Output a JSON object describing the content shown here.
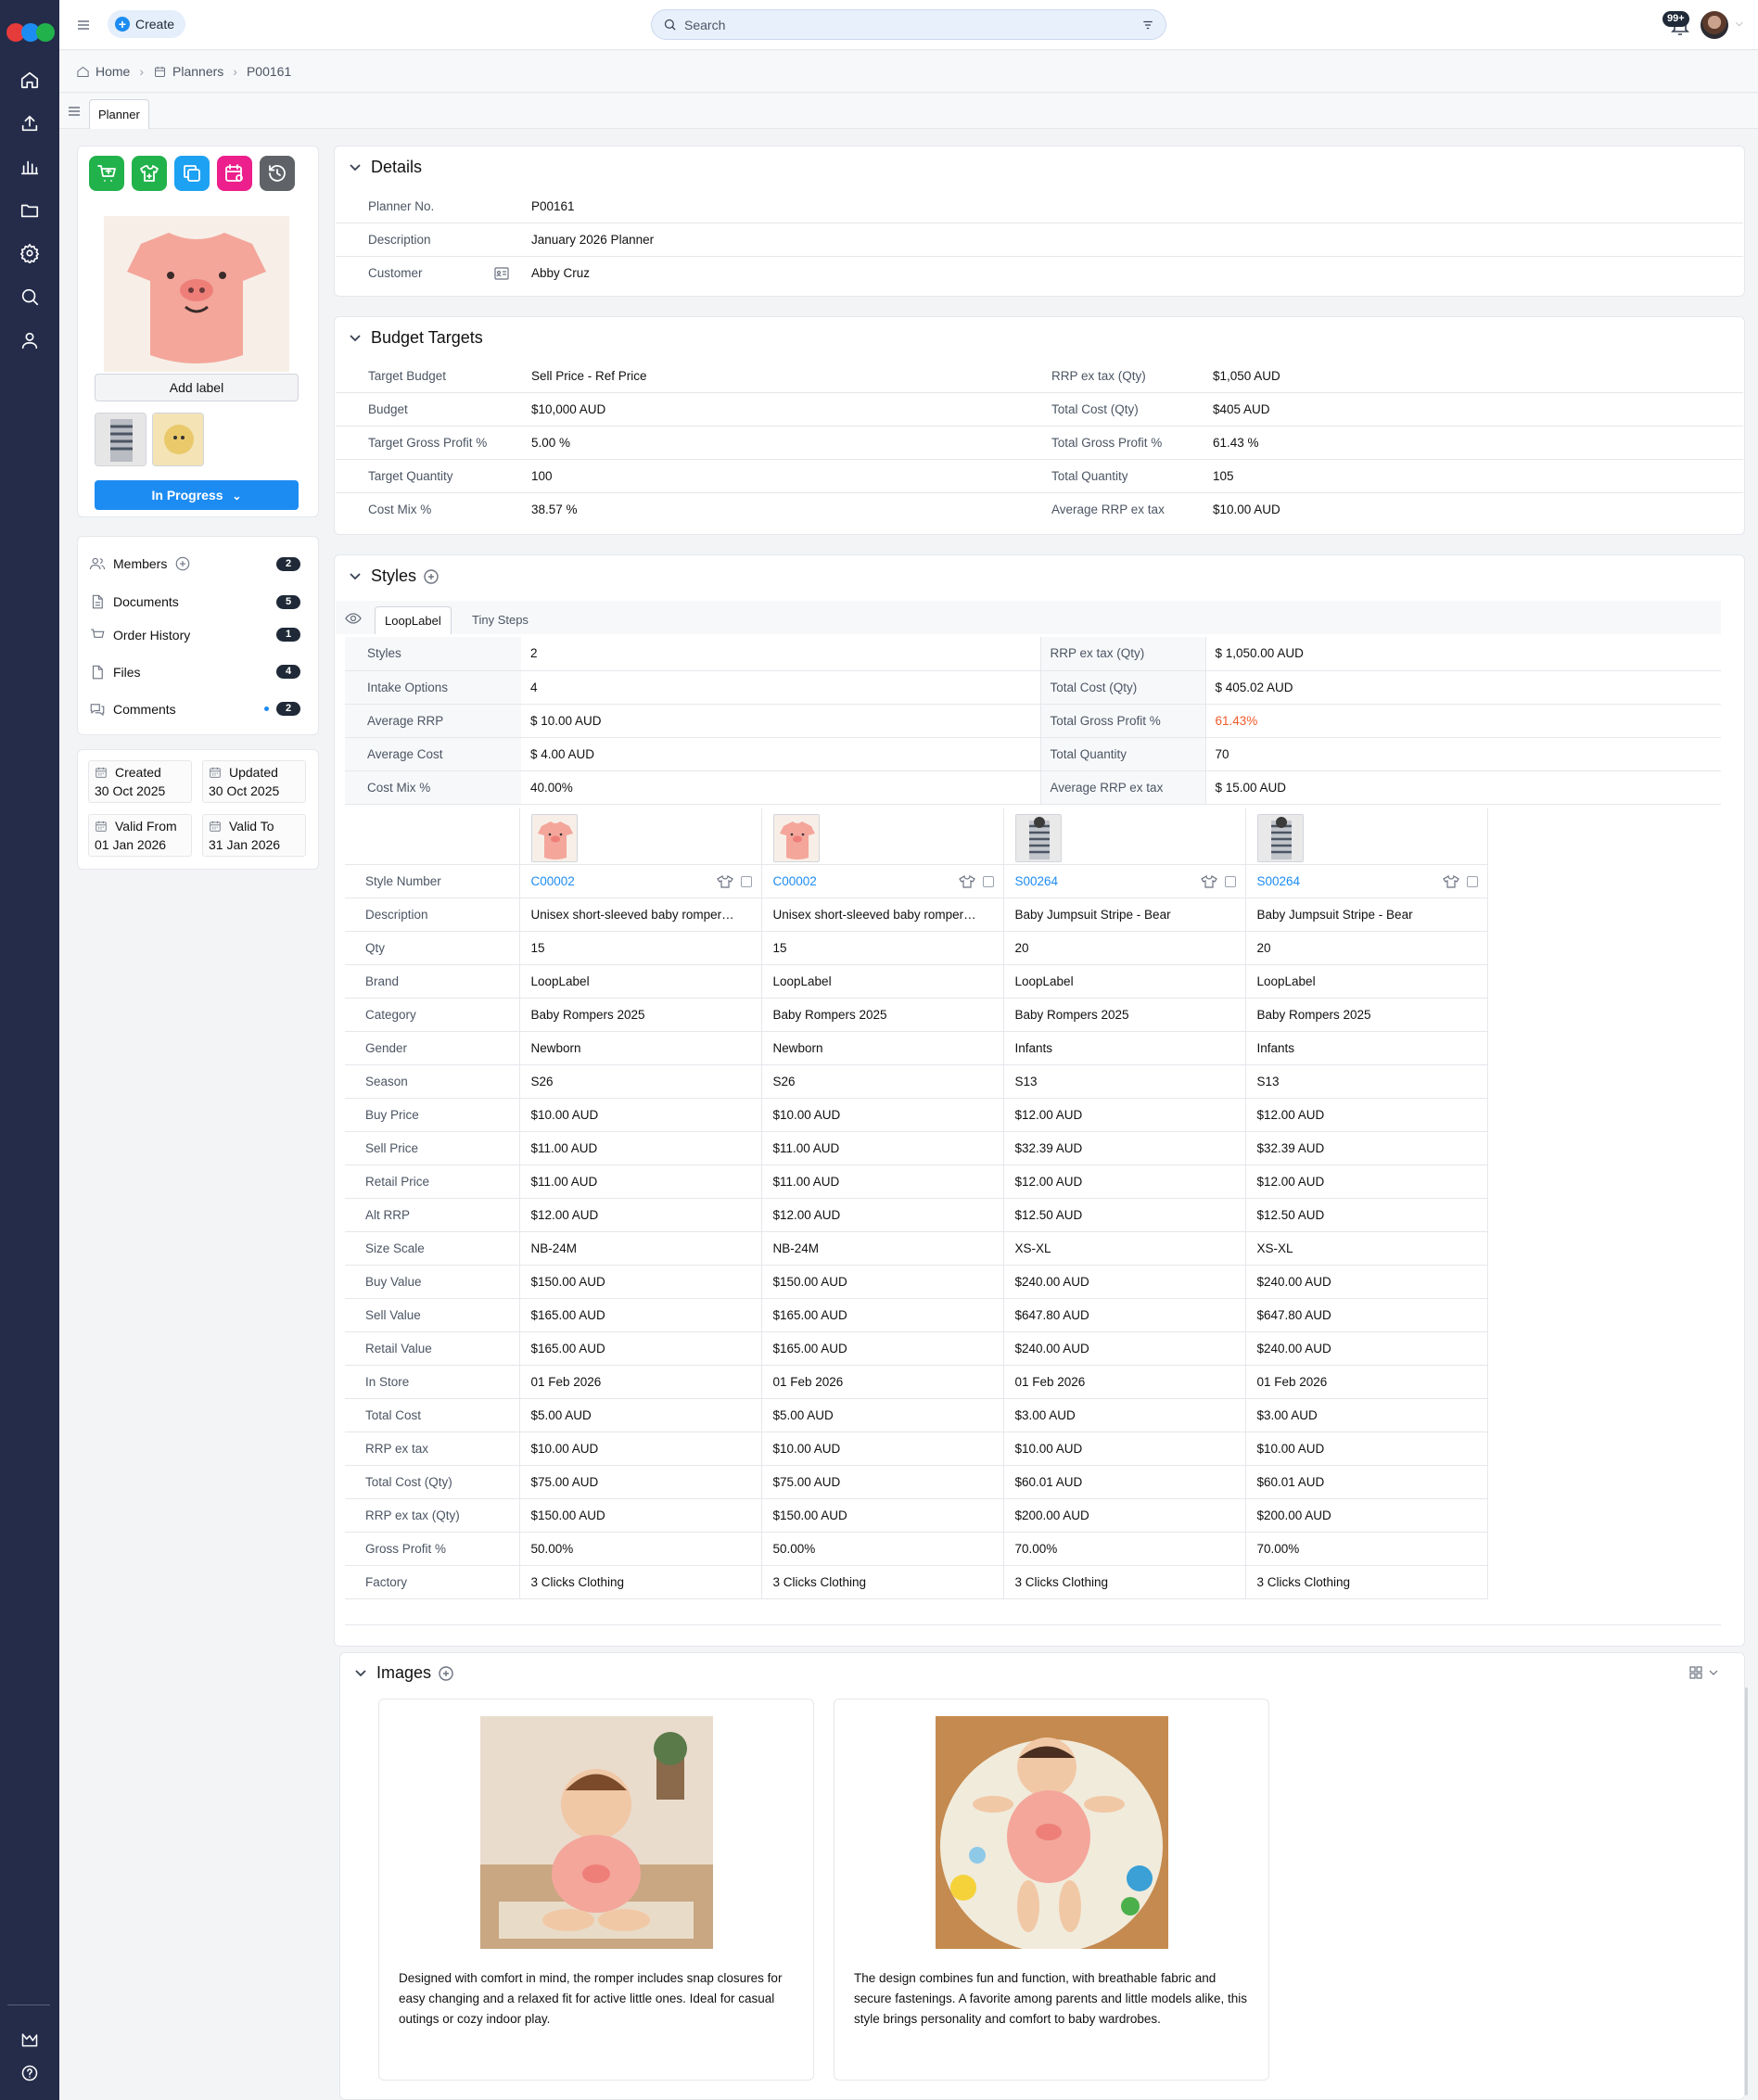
{
  "topbar": {
    "create_label": "Create",
    "search_placeholder": "Search",
    "notifications": "99+"
  },
  "breadcrumb": {
    "home": "Home",
    "planners": "Planners",
    "current": "P00161"
  },
  "tabs": {
    "planner": "Planner"
  },
  "sidebar": {
    "add_label": "Add label",
    "status": "In Progress",
    "links": [
      {
        "label": "Members",
        "count": "2"
      },
      {
        "label": "Documents",
        "count": "5"
      },
      {
        "label": "Order History",
        "count": "1"
      },
      {
        "label": "Files",
        "count": "4"
      },
      {
        "label": "Comments",
        "count": "2"
      }
    ],
    "dates": {
      "created_label": "Created",
      "created": "30 Oct 2025",
      "updated_label": "Updated",
      "updated": "30 Oct 2025",
      "valid_from_label": "Valid From",
      "valid_from": "01 Jan 2026",
      "valid_to_label": "Valid To",
      "valid_to": "31 Jan 2026"
    }
  },
  "details": {
    "title": "Details",
    "planner_no_label": "Planner No.",
    "planner_no": "P00161",
    "description_label": "Description",
    "description": "January 2026 Planner",
    "customer_label": "Customer",
    "customer": "Abby Cruz"
  },
  "budget": {
    "title": "Budget Targets",
    "left": [
      {
        "k": "Target Budget",
        "v": "Sell Price - Ref Price"
      },
      {
        "k": "Budget",
        "v": "$10,000 AUD"
      },
      {
        "k": "Target Gross Profit %",
        "v": "5.00 %"
      },
      {
        "k": "Target Quantity",
        "v": "100"
      },
      {
        "k": "Cost Mix %",
        "v": "38.57 %"
      }
    ],
    "right": [
      {
        "k": "RRP ex tax (Qty)",
        "v": "$1,050 AUD"
      },
      {
        "k": "Total Cost (Qty)",
        "v": "$405 AUD"
      },
      {
        "k": "Total Gross Profit %",
        "v": "61.43 %"
      },
      {
        "k": "Total Quantity",
        "v": "105"
      },
      {
        "k": "Average RRP ex tax",
        "v": "$10.00 AUD"
      }
    ]
  },
  "styles": {
    "title": "Styles",
    "brand_tabs": [
      "LoopLabel",
      "Tiny Steps"
    ],
    "summary": [
      {
        "k": "Styles",
        "v": "2",
        "k2": "RRP ex tax (Qty)",
        "v2": "$ 1,050.00 AUD"
      },
      {
        "k": "Intake Options",
        "v": "4",
        "k2": "Total Cost (Qty)",
        "v2": "$ 405.02 AUD"
      },
      {
        "k": "Average RRP",
        "v": "$ 10.00 AUD",
        "k2": "Total Gross Profit %",
        "v2": "61.43%"
      },
      {
        "k": "Average Cost",
        "v": "$ 4.00 AUD",
        "k2": "Total Quantity",
        "v2": "70"
      },
      {
        "k": "Cost Mix %",
        "v": "40.00%",
        "k2": "Average RRP ex tax",
        "v2": "$ 15.00 AUD"
      }
    ],
    "row_labels": [
      "Style Number",
      "Description",
      "Qty",
      "Brand",
      "Category",
      "Gender",
      "Season",
      "Buy Price",
      "Sell Price",
      "Retail Price",
      "Alt RRP",
      "Size Scale",
      "Buy Value",
      "Sell Value",
      "Retail Value",
      "In Store",
      "Total Cost",
      "RRP ex tax",
      "Total Cost (Qty)",
      "RRP ex tax (Qty)",
      "Gross Profit %",
      "Factory"
    ],
    "columns": [
      {
        "swatch": "pig",
        "values": [
          "C00002",
          "Unisex short-sleeved baby romper…",
          "15",
          "LoopLabel",
          "Baby Rompers 2025",
          "Newborn",
          "S26",
          "$10.00 AUD",
          "$11.00 AUD",
          "$11.00 AUD",
          "$12.00 AUD",
          "NB-24M",
          "$150.00 AUD",
          "$165.00 AUD",
          "$165.00 AUD",
          "01 Feb 2026",
          "$5.00 AUD",
          "$10.00 AUD",
          "$75.00 AUD",
          "$150.00 AUD",
          "50.00%",
          "3 Clicks Clothing"
        ]
      },
      {
        "swatch": "pig",
        "values": [
          "C00002",
          "Unisex short-sleeved baby romper…",
          "15",
          "LoopLabel",
          "Baby Rompers 2025",
          "Newborn",
          "S26",
          "$10.00 AUD",
          "$11.00 AUD",
          "$11.00 AUD",
          "$12.00 AUD",
          "NB-24M",
          "$150.00 AUD",
          "$165.00 AUD",
          "$165.00 AUD",
          "01 Feb 2026",
          "$5.00 AUD",
          "$10.00 AUD",
          "$75.00 AUD",
          "$150.00 AUD",
          "50.00%",
          "3 Clicks Clothing"
        ]
      },
      {
        "swatch": "stripe",
        "values": [
          "S00264",
          "Baby Jumpsuit Stripe - Bear",
          "20",
          "LoopLabel",
          "Baby Rompers 2025",
          "Infants",
          "S13",
          "$12.00 AUD",
          "$32.39 AUD",
          "$12.00 AUD",
          "$12.50 AUD",
          "XS-XL",
          "$240.00 AUD",
          "$647.80 AUD",
          "$240.00 AUD",
          "01 Feb 2026",
          "$3.00 AUD",
          "$10.00 AUD",
          "$60.01 AUD",
          "$200.00 AUD",
          "70.00%",
          "3 Clicks Clothing"
        ]
      },
      {
        "swatch": "stripe",
        "values": [
          "S00264",
          "Baby Jumpsuit Stripe - Bear",
          "20",
          "LoopLabel",
          "Baby Rompers 2025",
          "Infants",
          "S13",
          "$12.00 AUD",
          "$32.39 AUD",
          "$12.00 AUD",
          "$12.50 AUD",
          "XS-XL",
          "$240.00 AUD",
          "$647.80 AUD",
          "$240.00 AUD",
          "01 Feb 2026",
          "$3.00 AUD",
          "$10.00 AUD",
          "$60.01 AUD",
          "$200.00 AUD",
          "70.00%",
          "3 Clicks Clothing"
        ]
      }
    ]
  },
  "images": {
    "title": "Images",
    "cards": [
      {
        "text": "Designed with comfort in mind, the romper includes snap closures for easy changing and a relaxed fit for active little ones. Ideal for casual outings or cozy indoor play."
      },
      {
        "text": "The design combines fun and function, with breathable fabric and secure fastenings. A favorite among parents and little models alike, this style brings personality and comfort to baby wardrobes."
      }
    ]
  },
  "colors": {
    "accent": "#1d8cf2",
    "rail": "#242c4a",
    "warning": "#ef5a29",
    "green": "#22b24c",
    "cyan": "#1da1f2",
    "pink": "#ec1f8c",
    "gray": "#5f6368"
  }
}
